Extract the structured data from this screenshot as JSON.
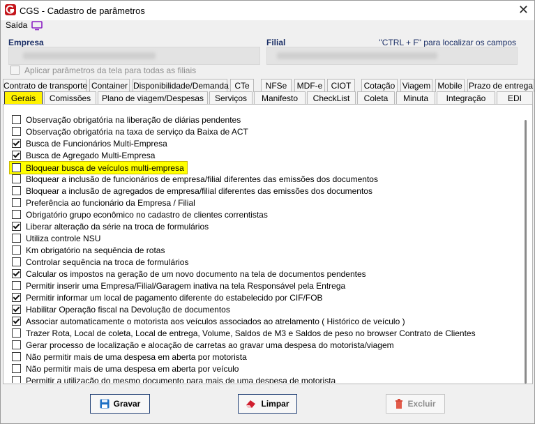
{
  "window": {
    "title": "CGS - Cadastro de parâmetros",
    "close_glyph": "✕"
  },
  "menu": {
    "saida": "Saída",
    "icon": "monitor-icon"
  },
  "header": {
    "empresa_label": "Empresa",
    "filial_label": "Filial",
    "hint": "\"CTRL + F\" para localizar os campos",
    "apply_all": "Aplicar parâmetros da tela para todas as filiais"
  },
  "tabs_row1": [
    "Contrato de transporte",
    "Container",
    "Disponibilidade/Demanda",
    "CTe",
    "NFSe",
    "MDF-e",
    "CIOT",
    "Cotação",
    "Viagem",
    "Mobile",
    "Prazo de entrega"
  ],
  "tabs_row2": [
    "Gerais",
    "Comissões",
    "Plano de viagem/Despesas",
    "Serviços",
    "Manifesto",
    "CheckList",
    "Coleta",
    "Minuta",
    "Integração",
    "EDI"
  ],
  "active_tab": "Gerais",
  "options": [
    {
      "label": "Observação obrigatória na liberação de diárias pendentes",
      "checked": false
    },
    {
      "label": "Observação obrigatória na taxa de serviço da Baixa de ACT",
      "checked": false
    },
    {
      "label": "Busca de Funcionários Multi-Empresa",
      "checked": true
    },
    {
      "label": "Busca de Agregado Multi-Empresa",
      "checked": true
    },
    {
      "label": "Bloquear busca de veículos multi-empresa",
      "checked": false,
      "highlighted": true
    },
    {
      "label": "Bloquear a inclusão de funcionários de empresa/filial diferentes das emissões dos documentos",
      "checked": false
    },
    {
      "label": "Bloquear a inclusão de agregados de empresa/filial diferentes das emissões dos documentos",
      "checked": false
    },
    {
      "label": "Preferência ao funcionário da Empresa / Filial",
      "checked": false
    },
    {
      "label": "Obrigatório grupo econômico no cadastro de clientes correntistas",
      "checked": false
    },
    {
      "label": "Liberar alteração da série na troca de formulários",
      "checked": true
    },
    {
      "label": "Utiliza controle NSU",
      "checked": false
    },
    {
      "label": "Km obrigatório na sequência de rotas",
      "checked": false
    },
    {
      "label": "Controlar sequência na troca de formulários",
      "checked": false
    },
    {
      "label": "Calcular os impostos na geração de um novo documento na tela de documentos pendentes",
      "checked": true
    },
    {
      "label": "Permitir inserir uma Empresa/Filial/Garagem inativa na tela Responsável pela Entrega",
      "checked": false
    },
    {
      "label": "Permitir informar um local de pagamento diferente do estabelecido por CIF/FOB",
      "checked": true
    },
    {
      "label": "Habilitar Operação fiscal na Devolução de documentos",
      "checked": true
    },
    {
      "label": "Associar automaticamente o motorista aos veículos associados ao atrelamento ( Histórico de veículo )",
      "checked": true
    },
    {
      "label": "Trazer Rota, Local de coleta, Local de entrega, Volume, Saldos de M3 e Saldos de peso no browser Contrato de Clientes",
      "checked": false
    },
    {
      "label": "Gerar processo de localização e alocação de carretas ao gravar uma despesa do motorista/viagem",
      "checked": false
    },
    {
      "label": "Não permitir mais de uma despesa em aberta por motorista",
      "checked": false
    },
    {
      "label": "Não permitir mais de uma despesa em aberta por veículo",
      "checked": false
    },
    {
      "label": "Permitir a utilização do mesmo documento para mais de uma despesa de motorista",
      "checked": false
    }
  ],
  "buttons": {
    "save": "Gravar",
    "clear": "Limpar",
    "delete": "Excluir"
  },
  "colors": {
    "accent": "#1b2f66",
    "highlight": "#ffff00",
    "logo": "#c4161c"
  }
}
